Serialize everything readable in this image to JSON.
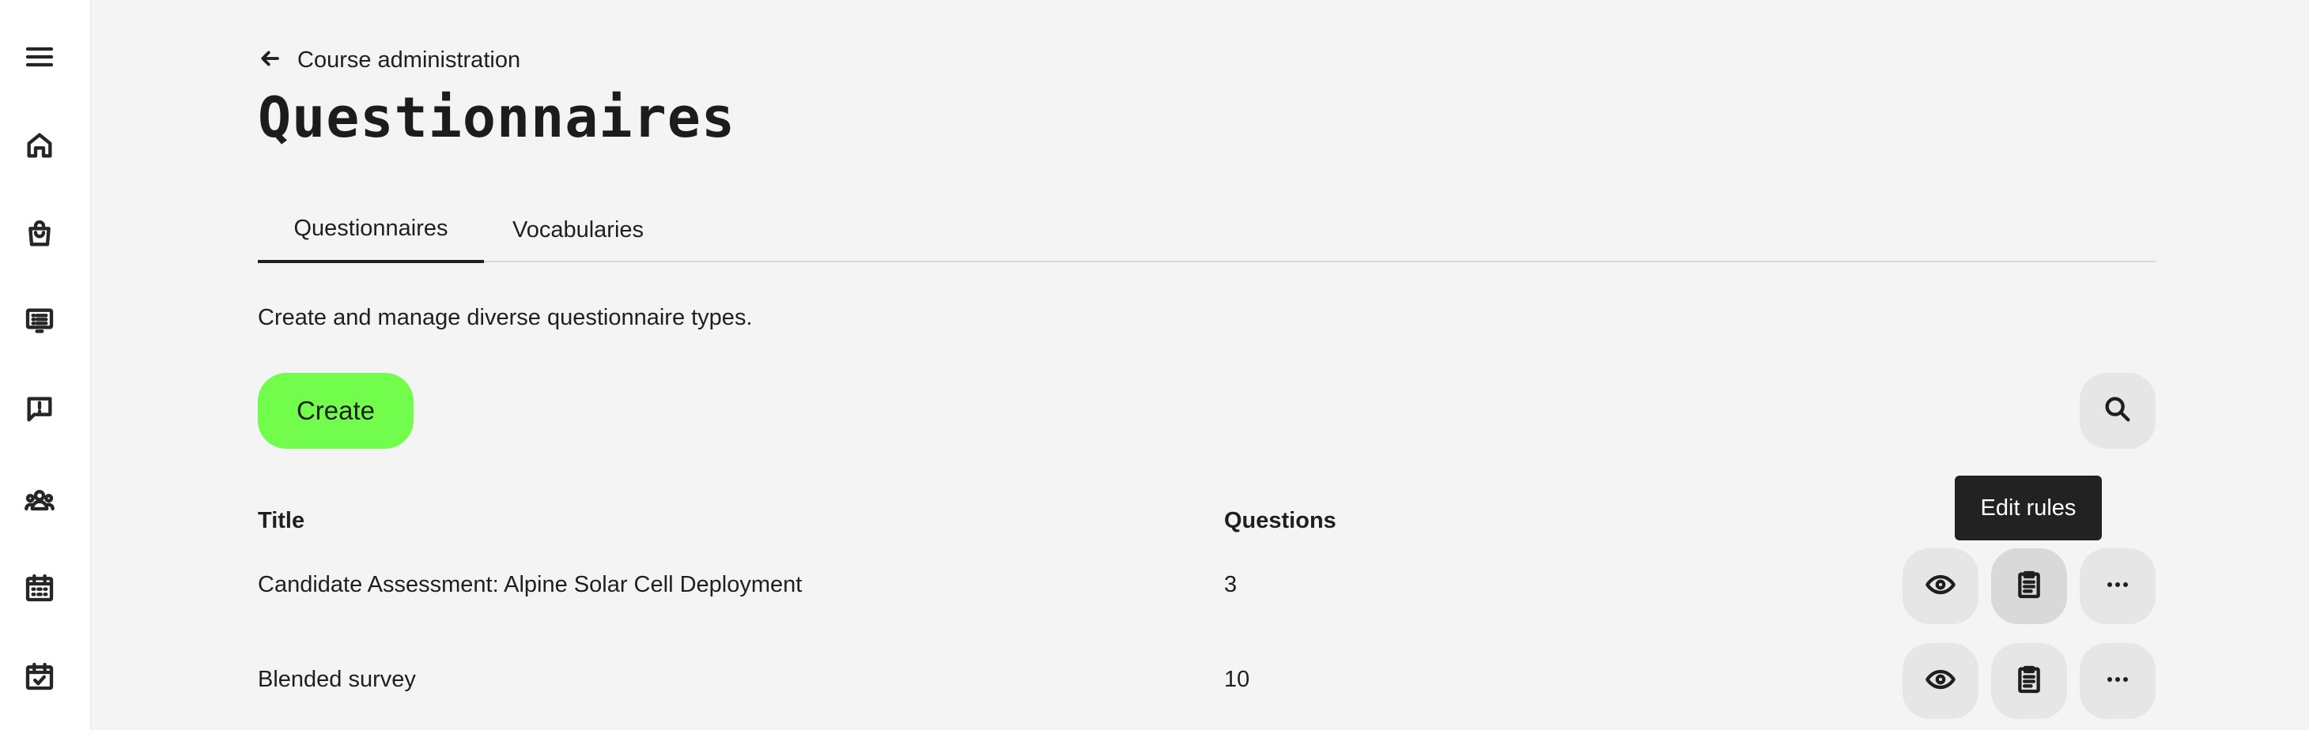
{
  "sidebar": {
    "items": [
      {
        "name": "menu-icon"
      },
      {
        "name": "home-icon"
      },
      {
        "name": "shopping-bag-icon"
      },
      {
        "name": "course-list-icon"
      },
      {
        "name": "feedback-icon"
      },
      {
        "name": "people-icon"
      },
      {
        "name": "calendar-icon"
      },
      {
        "name": "calendar-check-icon"
      }
    ]
  },
  "breadcrumb": {
    "label": "Course administration",
    "icon": "arrow-left-icon"
  },
  "page": {
    "title": "Questionnaires",
    "description": "Create and manage diverse questionnaire types."
  },
  "tabs": [
    {
      "label": "Questionnaires",
      "active": true
    },
    {
      "label": "Vocabularies",
      "active": false
    }
  ],
  "toolbar": {
    "create_label": "Create",
    "search_icon": "search-icon"
  },
  "table": {
    "columns": [
      "Title",
      "Questions"
    ],
    "rows": [
      {
        "title": "Candidate Assessment: Alpine Solar Cell Deployment",
        "questions": "3"
      },
      {
        "title": "Blended survey",
        "questions": "10"
      }
    ],
    "row_actions": [
      "eye-icon",
      "clipboard-icon",
      "more-icon"
    ]
  },
  "tooltip": {
    "text": "Edit rules"
  },
  "colors": {
    "accent": "#72fc4c",
    "background": "#f4f4f4",
    "sidebar": "#ffffff",
    "tooltip": "#222222"
  }
}
